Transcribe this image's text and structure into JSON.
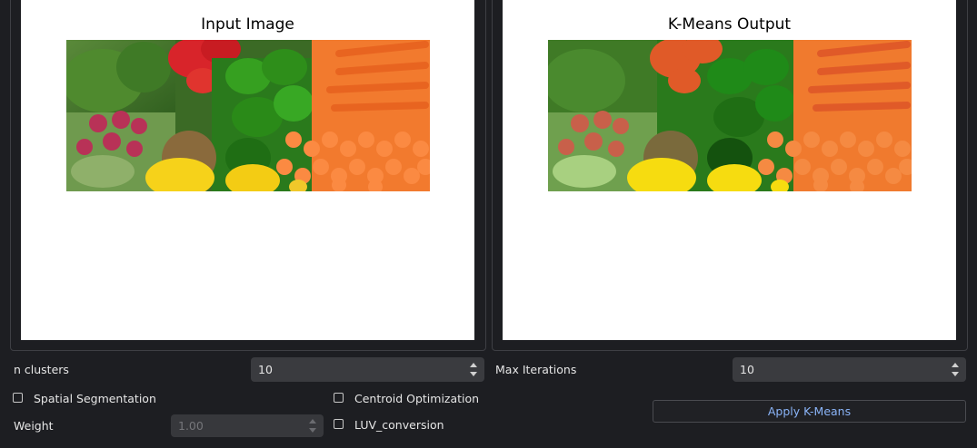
{
  "input_panel": {
    "title": "Input Image"
  },
  "output_panel": {
    "title": "K-Means Output"
  },
  "controls": {
    "n_clusters": {
      "label": "n clusters",
      "value": "10"
    },
    "max_iterations": {
      "label": "Max Iterations",
      "value": "10"
    },
    "spatial_segmentation": {
      "label": "Spatial Segmentation",
      "checked": false
    },
    "centroid_optimization": {
      "label": "Centroid Optimization",
      "checked": false
    },
    "weight": {
      "label": "Weight",
      "value": "1.00",
      "enabled": false
    },
    "luv_conversion": {
      "label": "LUV_conversion",
      "checked": false
    },
    "apply_button": {
      "label": "Apply K-Means"
    }
  },
  "colors": {
    "background": "#1d1e22",
    "canvas": "#ffffff",
    "input_field": "#3a3b3f",
    "button_text": "#8ab4f8"
  }
}
